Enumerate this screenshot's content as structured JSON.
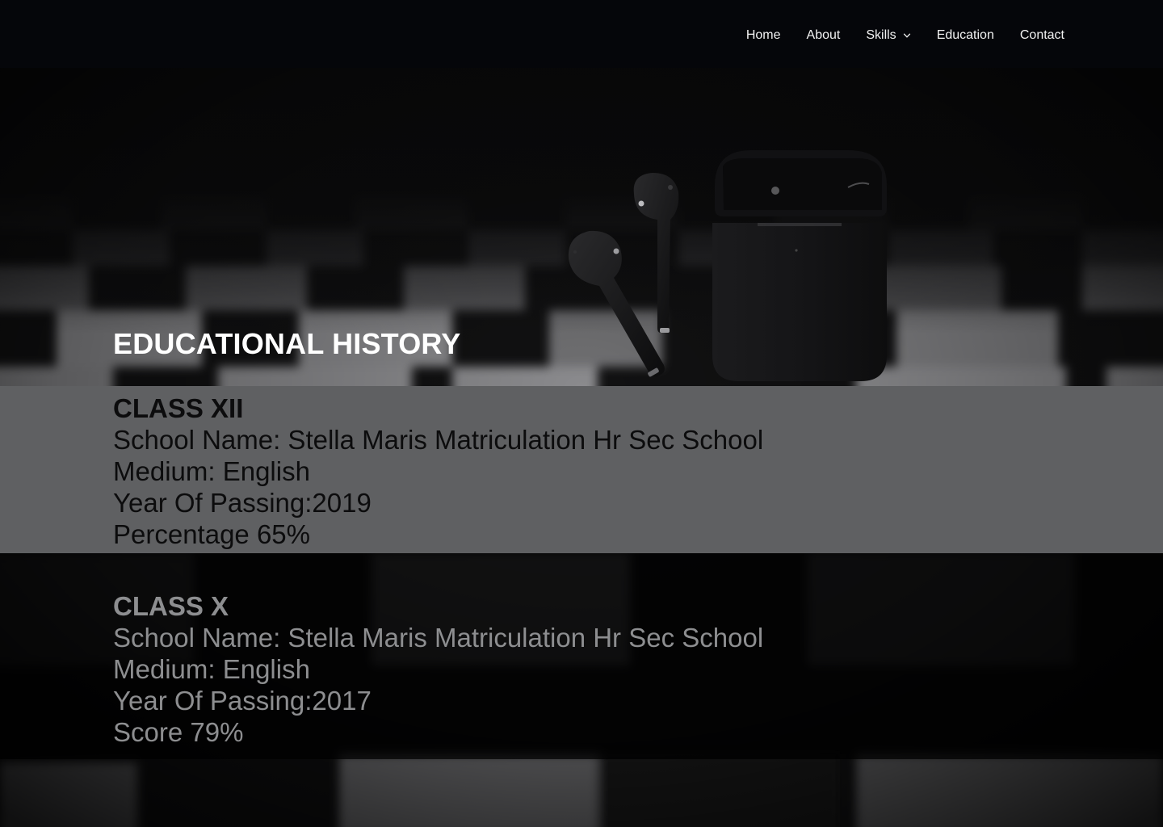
{
  "nav": {
    "items": [
      {
        "label": "Home"
      },
      {
        "label": "About"
      },
      {
        "label": "Skills",
        "has_dropdown": true
      },
      {
        "label": "Education"
      },
      {
        "label": "Contact"
      }
    ],
    "dropdown_icon": "chevron-down-icon"
  },
  "hero": {
    "title": "EDUCATIONAL HISTORY",
    "image": "airpods-on-chessboard"
  },
  "education": [
    {
      "heading": "CLASS XII",
      "school_line": "School Name: Stella Maris Matriculation Hr Sec School",
      "medium_line": "Medium: English",
      "year_line": "Year Of Passing:2019",
      "score_line": "Percentage 65%"
    },
    {
      "heading": "CLASS X",
      "school_line": "School Name: Stella Maris Matriculation Hr Sec School",
      "medium_line": "Medium: English",
      "year_line": "Year Of Passing:2017",
      "score_line": "Score 79%"
    }
  ],
  "colors": {
    "header_bg": "#05060a",
    "band_xii_bg": "#5f6062",
    "band_xii_text": "#0c0c0d",
    "band_x_text": "#8d8e90",
    "hero_title": "#ffffff"
  }
}
